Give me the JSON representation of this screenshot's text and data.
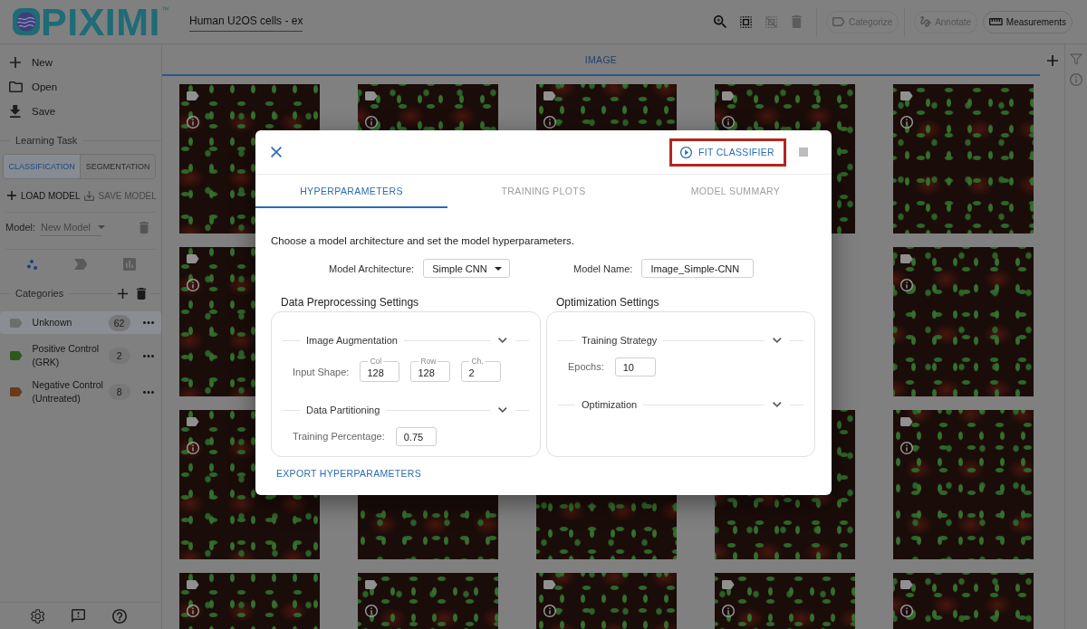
{
  "header": {
    "logo": {
      "name": "PIXIMI",
      "trademark": "™"
    },
    "project_name": "Human U2OS cells - ex",
    "tool_buttons": [
      {
        "disabled": false
      },
      {
        "disabled": false
      },
      {
        "disabled": true
      },
      {
        "disabled": true
      }
    ],
    "mode_buttons": [
      {
        "label": "Categorize",
        "disabled": true
      },
      {
        "label": "Annotate",
        "disabled": true
      },
      {
        "label": "Measurements",
        "disabled": false
      }
    ]
  },
  "sidebar": {
    "file_menu": [
      {
        "label": "New"
      },
      {
        "label": "Open"
      },
      {
        "label": "Save"
      }
    ],
    "learning_task": {
      "title": "Learning Task",
      "options": [
        {
          "label": "CLASSIFICATION",
          "selected": true
        },
        {
          "label": "SEGMENTATION",
          "selected": false
        }
      ]
    },
    "model_actions": [
      {
        "label": "LOAD MODEL",
        "disabled": false
      },
      {
        "label": "SAVE MODEL",
        "disabled": true
      }
    ],
    "model_select": {
      "label": "Model:",
      "value": "New Model",
      "disabled": true
    },
    "view_tabs": [
      {
        "selected": true
      },
      {
        "selected": false
      },
      {
        "selected": false
      }
    ],
    "categories": {
      "title": "Categories",
      "items": [
        {
          "name": "Unknown",
          "count": "62",
          "color": "#6e6e6e",
          "selected": true
        },
        {
          "name": "Positive Control (GRK)",
          "count": "2",
          "color": "#2b5a1d",
          "selected": false
        },
        {
          "name": "Negative Control (Untreated)",
          "count": "8",
          "color": "#6a3a16",
          "selected": false
        }
      ]
    }
  },
  "main": {
    "tabs": [
      {
        "label": "IMAGE",
        "selected": true
      }
    ]
  },
  "dialog": {
    "fit_button": {
      "label": "FIT CLASSIFIER",
      "highlighted": true
    },
    "stop_button": {
      "disabled": true
    },
    "tabs": [
      {
        "label": "HYPERPARAMETERS",
        "selected": true
      },
      {
        "label": "TRAINING PLOTS",
        "selected": false
      },
      {
        "label": "MODEL SUMMARY",
        "selected": false
      }
    ],
    "intro": "Choose a model architecture and set the model hyperparameters.",
    "architecture": {
      "label": "Model Architecture:",
      "value": "Simple CNN"
    },
    "model_name": {
      "label": "Model Name:",
      "value": "Image_Simple-CNN"
    },
    "panels": [
      {
        "title": "Data Preprocessing Settings",
        "sections": [
          {
            "title": "Image Augmentation",
            "rows": [
              {
                "label": "Input Shape:",
                "inputs": [
                  {
                    "label": "Col",
                    "value": "128"
                  },
                  {
                    "label": "Row",
                    "value": "128"
                  },
                  {
                    "label": "Ch.",
                    "value": "2"
                  }
                ]
              }
            ]
          },
          {
            "title": "Data Partitioning",
            "rows": [
              {
                "label": "Training Percentage:",
                "inputs": [
                  {
                    "value": "0.75"
                  }
                ]
              }
            ]
          }
        ]
      },
      {
        "title": "Optimization Settings",
        "sections": [
          {
            "title": "Training Strategy",
            "rows": [
              {
                "label": "Epochs:",
                "inputs": [
                  {
                    "value": "10"
                  }
                ]
              }
            ]
          },
          {
            "title": "Optimization"
          }
        ]
      }
    ],
    "export_button": "EXPORT HYPERPARAMETERS"
  }
}
